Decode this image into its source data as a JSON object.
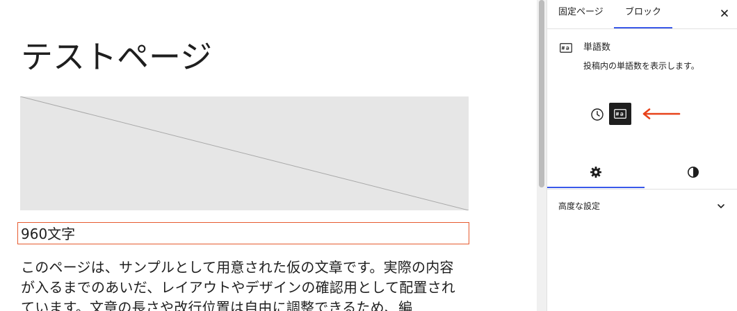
{
  "editor": {
    "page_title": "テストページ",
    "word_count_text": "960文字",
    "paragraph_text": "このページは、サンプルとして用意された仮の文章です。実際の内容が入るまでのあいだ、レイアウトやデザインの確認用として配置されています。文章の長さや改行位置は自由に調整できるため、編"
  },
  "sidebar": {
    "tabs": [
      {
        "label": "固定ページ",
        "active": false
      },
      {
        "label": "ブロック",
        "active": true
      }
    ],
    "close_label": "×",
    "block_card": {
      "icon": "word-count-icon",
      "title": "単語数",
      "description": "投稿内の単語数を表示します。"
    },
    "variations": [
      {
        "icon": "clock-icon",
        "selected": false
      },
      {
        "icon": "word-count-icon",
        "selected": true
      }
    ],
    "annotation": {
      "icon": "arrow-left-icon",
      "color": "#e8421a"
    },
    "settings_tabs": [
      {
        "icon": "gear-icon",
        "active": true
      },
      {
        "icon": "half-circle-contrast-icon",
        "active": false
      }
    ],
    "advanced_panel": {
      "label": "高度な設定",
      "icon": "chevron-down-icon"
    }
  },
  "colors": {
    "accent": "#3858e9",
    "selection_outline": "#e65a2e",
    "text": "#1e1e1e",
    "placeholder_bg": "#e6e6e6"
  }
}
